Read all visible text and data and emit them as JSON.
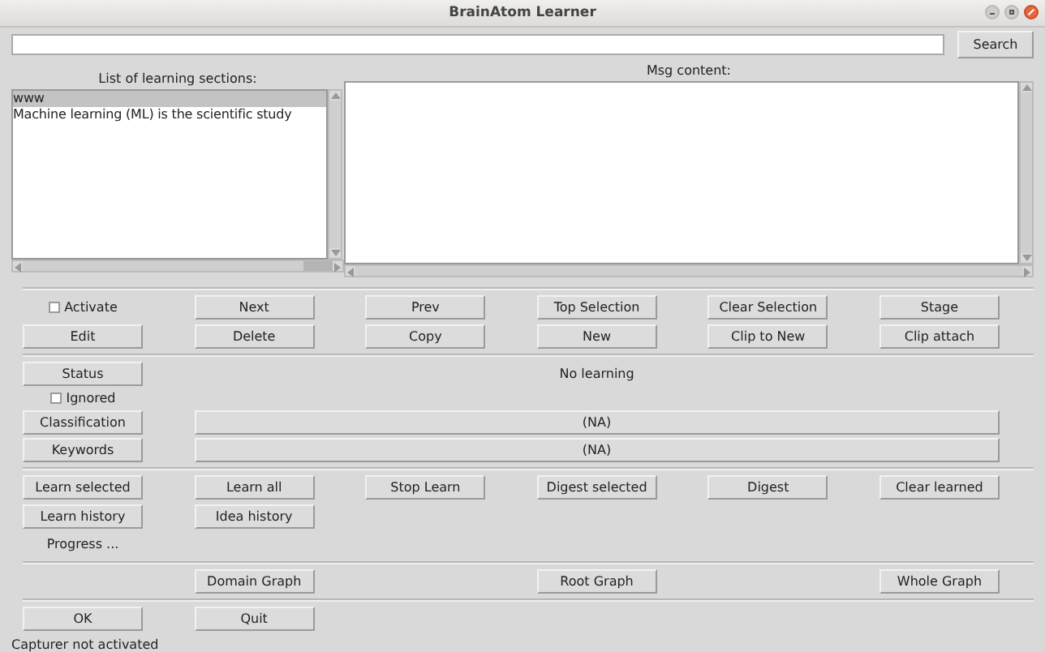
{
  "window": {
    "title": "BrainAtom Learner"
  },
  "search": {
    "button": "Search"
  },
  "sections_list": {
    "label": "List of learning sections:",
    "items": [
      {
        "text": "www",
        "selected": true
      },
      {
        "text": "Machine learning (ML) is the scientific study",
        "selected": false
      }
    ]
  },
  "msg_content": {
    "label": "Msg content:"
  },
  "actions": [
    {
      "kind": "checkbox",
      "label": "Activate",
      "checked": false
    },
    {
      "kind": "button",
      "label": "Next"
    },
    {
      "kind": "button",
      "label": "Prev"
    },
    {
      "kind": "button",
      "label": "Top Selection"
    },
    {
      "kind": "button",
      "label": "Clear Selection"
    },
    {
      "kind": "button",
      "label": "Stage"
    },
    {
      "kind": "button",
      "label": "Edit"
    },
    {
      "kind": "button",
      "label": "Delete"
    },
    {
      "kind": "button",
      "label": "Copy"
    },
    {
      "kind": "button",
      "label": "New"
    },
    {
      "kind": "button",
      "label": "Clip to New"
    },
    {
      "kind": "button",
      "label": "Clip attach"
    }
  ],
  "status": {
    "button": "Status",
    "text": "No learning",
    "ignored": {
      "label": "Ignored",
      "checked": false
    },
    "classification": {
      "button": "Classification",
      "value": "(NA)"
    },
    "keywords": {
      "button": "Keywords",
      "value": "(NA)"
    }
  },
  "learning": {
    "rows": [
      [
        "Learn selected",
        "Learn all",
        "Stop Learn",
        "Digest selected",
        "Digest",
        "Clear learned"
      ],
      [
        "Learn history",
        "Idea history"
      ]
    ],
    "progress": "Progress ..."
  },
  "graph_buttons": [
    "Domain Graph",
    "Root Graph",
    "Whole Graph"
  ],
  "bottom_buttons": [
    "OK",
    "Quit"
  ],
  "status_bar": "Capturer not activated"
}
